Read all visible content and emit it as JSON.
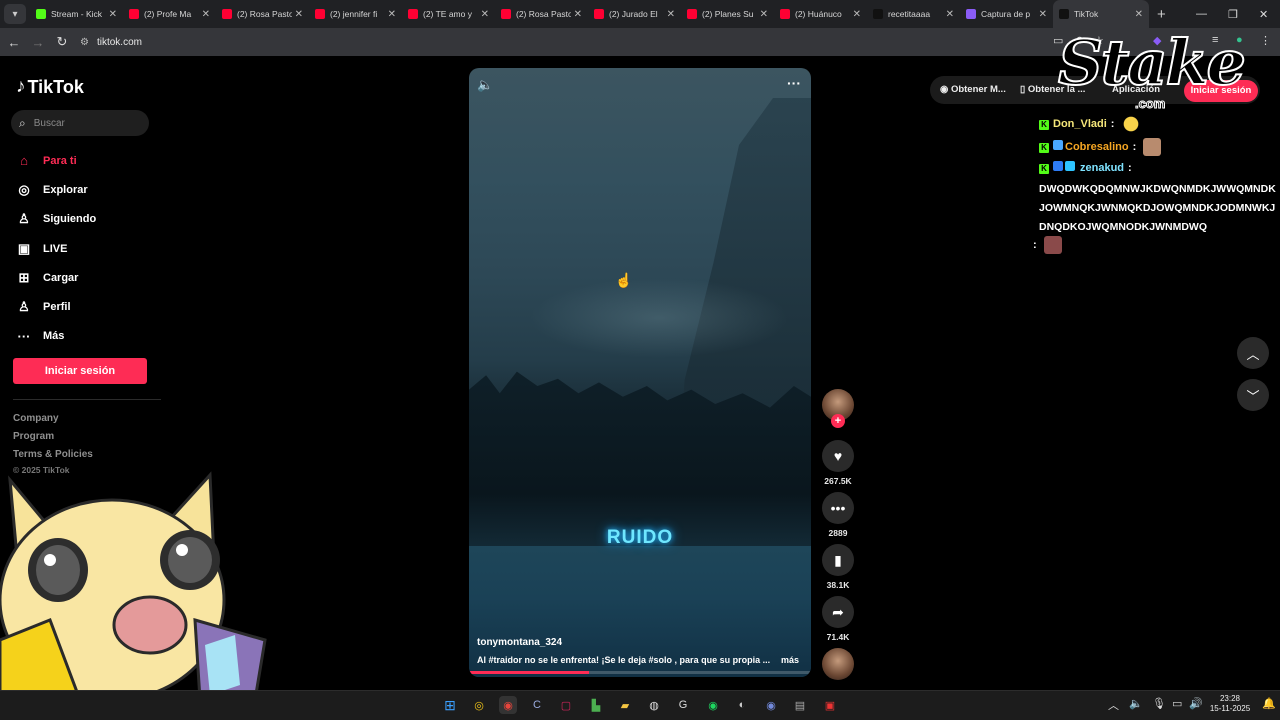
{
  "browser": {
    "tabs": [
      {
        "title": "Stream - Kick",
        "favicon_color": "#53fc18"
      },
      {
        "title": "(2) Profe Ma",
        "favicon_color": "#ff0033"
      },
      {
        "title": "(2) Rosa Pasto",
        "favicon_color": "#ff0033"
      },
      {
        "title": "(2) jennifer fi",
        "favicon_color": "#ff0033"
      },
      {
        "title": "(2) TE amo y",
        "favicon_color": "#ff0033"
      },
      {
        "title": "(2) Rosa Pasto",
        "favicon_color": "#ff0033"
      },
      {
        "title": "(2) Jurado El",
        "favicon_color": "#ff0033"
      },
      {
        "title": "(2) Planes Su",
        "favicon_color": "#ff0033"
      },
      {
        "title": "(2) Huánuco",
        "favicon_color": "#ff0033"
      },
      {
        "title": "recetitaaaa",
        "favicon_color": "#111111"
      },
      {
        "title": "Captura de p",
        "favicon_color": "#8a5cf6"
      },
      {
        "title": "TikTok",
        "favicon_color": "#111111",
        "active": true
      }
    ],
    "url": "tiktok.com"
  },
  "sidebar": {
    "logo": "TikTok",
    "search_placeholder": "Buscar",
    "nav": [
      {
        "label": "Para ti",
        "icon": "home-icon",
        "active": true
      },
      {
        "label": "Explorar",
        "icon": "compass-icon"
      },
      {
        "label": "Siguiendo",
        "icon": "following-icon"
      },
      {
        "label": "LIVE",
        "icon": "live-icon"
      },
      {
        "label": "Cargar",
        "icon": "upload-icon"
      },
      {
        "label": "Perfil",
        "icon": "profile-icon"
      },
      {
        "label": "Más",
        "icon": "more-icon"
      }
    ],
    "login_label": "Iniciar sesión",
    "footer": [
      "Company",
      "Program",
      "Terms & Policies"
    ],
    "copyright": "© 2025 TikTok"
  },
  "video": {
    "overlay_text": "RUIDO",
    "author": "tonymontana_324",
    "caption": "Al #traidor  no se le enfrenta! ¡Se le deja #solo , para que su propia ...",
    "more_label": "más",
    "progress": 0.35
  },
  "actions": {
    "likes": "267.5K",
    "comments": "2889",
    "saves": "38.1K",
    "shares": "71.4K"
  },
  "top_right": {
    "btn1": "Obtener M...",
    "btn2": "Obtener la ...",
    "btn3": "Aplicación",
    "login": "Iniciar sesión"
  },
  "overlay": {
    "brand": "Stake",
    "brand_suffix": ".com",
    "chat": [
      {
        "user": "Don_Vladi",
        "color": "#f5e67a"
      },
      {
        "user": "Cobresalino",
        "color": "#f5a623"
      },
      {
        "user": "zenakud",
        "color": "#7fe3ff"
      }
    ],
    "spam_text": "DWQDWKQDQMNWJKDWQNMDKJWWQMNDKJOWMNQKJWNMQKDJOWQMNDKJODMNWKJDNQDKOJWQMNODKJWNMDWQ",
    "sep": ":"
  },
  "taskbar": {
    "time": "23:28",
    "date": "15-11-2025"
  }
}
